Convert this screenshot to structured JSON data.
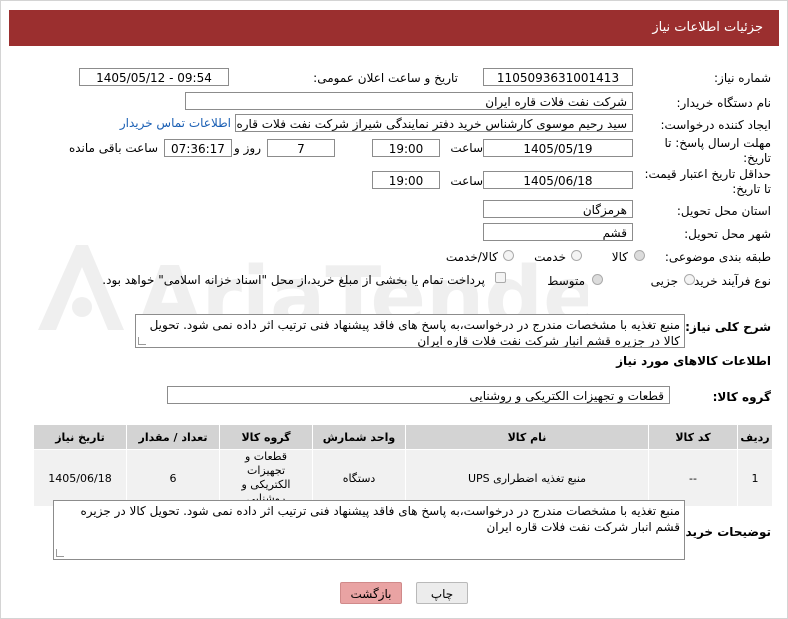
{
  "header": {
    "title": "جزئیات اطلاعات نیاز"
  },
  "fields": {
    "need_number_label": "شماره نیاز:",
    "need_number": "1105093631001413",
    "announce_label": "تاریخ و ساعت اعلان عمومی:",
    "announce_value": "1405/05/12 - 09:54",
    "buyer_org_label": "نام دستگاه خریدار:",
    "buyer_org": "شرکت نفت فلات قاره ایران",
    "creator_label": "ایجاد کننده درخواست:",
    "creator": "سید رحیم موسوی کارشناس خرید دفتر نمایندگی شیراز شرکت نفت فلات قاره ا",
    "contact_link": "اطلاعات تماس خریدار",
    "deadline_label": "مهلت ارسال پاسخ: تا تاریخ:",
    "deadline_date": "1405/05/19",
    "time_label": "ساعت",
    "deadline_time": "19:00",
    "days_value": "7",
    "days_label": "روز و",
    "remaining_value": "07:36:17",
    "remaining_label": "ساعت باقی مانده",
    "price_validity_label": "حداقل تاریخ اعتبار قیمت: تا تاریخ:",
    "price_validity_date": "1405/06/18",
    "price_validity_time": "19:00",
    "province_label": "استان محل تحویل:",
    "province": "هرمزگان",
    "city_label": "شهر محل تحویل:",
    "city": "قشم",
    "category_label": "طبقه بندی موضوعی:",
    "cat_goods": "کالا",
    "cat_service": "خدمت",
    "cat_goods_service": "کالا/خدمت",
    "process_label": "نوع فرآیند خرید :",
    "proc_partial": "جزیی",
    "proc_medium": "متوسط",
    "payment_note": "پرداخت تمام یا بخشی از مبلغ خرید،از محل \"اسناد خزانه اسلامی\" خواهد بود.",
    "summary_label": "شرح کلی نیاز:",
    "summary": "منبع تغذیه با مشخصات مندرج در درخواست،به پاسخ های فاقد پیشنهاد فنی ترتیب اثر داده نمی شود. تحویل کالا در جزیره قشم انبار شرکت نفت فلات قاره ایران",
    "items_info_label": "اطلاعات کالاهای مورد نیاز",
    "goods_group_label": "گروه کالا:",
    "goods_group": "قطعات و تجهیزات الکتریکی و روشنایی",
    "buyer_notes_label": "توضیحات خریدار:",
    "buyer_notes": "منبع تغذیه با مشخصات مندرج در درخواست،به پاسخ های فاقد پیشنهاد فنی ترتیب اثر داده نمی شود. تحویل کالا در جزیره قشم انبار شرکت نفت فلات قاره ایران"
  },
  "table": {
    "headers": [
      "ردیف",
      "کد کالا",
      "نام کالا",
      "واحد شمارش",
      "گروه کالا",
      "تعداد / مقدار",
      "تاریخ نیاز"
    ],
    "rows": [
      [
        "1",
        "--",
        "منبع تغذیه اضطراری UPS",
        "دستگاه",
        "قطعات و تجهیزات الکتریکی و روشنایی",
        "6",
        "1405/06/18"
      ]
    ]
  },
  "buttons": {
    "print": "چاپ",
    "back": "بازگشت"
  },
  "watermark": {
    "text": "AriaTender.net"
  },
  "colors": {
    "header_bg": "#9b2f2f",
    "back_button_bg": "#e9a3a3",
    "link": "#1a5fb4",
    "table_header": "#d3d3d3"
  }
}
